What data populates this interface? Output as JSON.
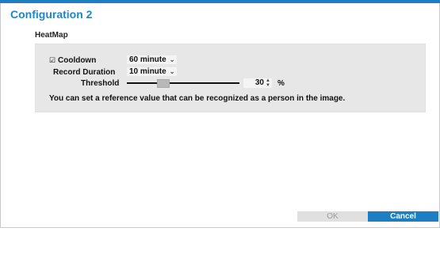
{
  "dialog": {
    "title": "Configuration 2",
    "section_label": "HeatMap"
  },
  "heatmap": {
    "cooldown": {
      "checked": true,
      "check_glyph": "☑",
      "label": "Cooldown",
      "value": "60 minute"
    },
    "record_duration": {
      "label": "Record Duration",
      "value": "10 minute"
    },
    "threshold": {
      "label": "Threshold",
      "value": "30",
      "unit": "%",
      "slider_fraction": 0.3
    },
    "hint": "You can set a reference value that can be recognized as a person in the image."
  },
  "buttons": {
    "ok_label": "OK",
    "cancel_label": "Cancel"
  },
  "icons": {
    "dropdown": "chevron-down-icon",
    "spin": "spin-arrows-icon",
    "checkbox": "checkbox-icon"
  },
  "colors": {
    "accent": "#1d7fc3",
    "title": "#1f86c8",
    "panel": "#e7e7e7",
    "disabled_button": "#e0e0e0"
  }
}
